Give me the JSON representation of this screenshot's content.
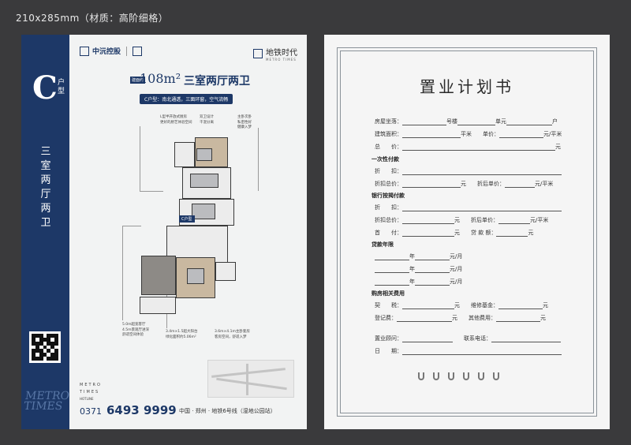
{
  "spec_caption": "210x285mm（材质：高阶细格）",
  "left": {
    "unit_letter": "C",
    "unit_sub": "户型",
    "band_text": "三室两厅两卫",
    "logo_left_name": "中沅控股",
    "logo_right_name": "地铁时代",
    "logo_right_en": "METRO TIMES",
    "area_badge": "建面约",
    "area": "108m²",
    "rooms": "三室两厅两卫",
    "c_tag": "C户型：南北通透，三面环窗，空气流畅",
    "plan_label": "C户型",
    "notes": [
      {
        "lines": [
          "L型半开放式厨房",
          "更好的厨艺体验空间"
        ]
      },
      {
        "lines": [
          "双卫设计",
          "干湿分离"
        ]
      },
      {
        "lines": [
          "主卧次卧",
          "私密性好",
          "健康入梦"
        ]
      },
      {
        "lines": [
          "5.0m超宽客厅",
          "4.5m景观厅进深",
          "舒适空间体验"
        ]
      },
      {
        "lines": [
          "3.4m×1.5超大阳台",
          "绿化面积约5.06m²"
        ]
      },
      {
        "lines": [
          "3.6m×4.1m主卧套房",
          "客房空间，舒适入梦"
        ]
      }
    ],
    "metro_en_1": "METRO",
    "metro_en_2": "TIMES",
    "deco_1": "METRO",
    "deco_2": "TIMES",
    "hotline_label": "HOTLINE",
    "area_code": "0371",
    "phone": "6493 9999",
    "address": "中国 · 郑州 · 地铁6号线（湿地公园站）"
  },
  "right": {
    "title": "置业计划书",
    "rows": {
      "house_no_label": "房屋坐落：",
      "bldg": "号楼",
      "unit": "单元",
      "hu": "户",
      "area_label": "建筑面积：",
      "sqm": "平米",
      "price_label": "单价：",
      "yuan_sqm": "元/平米",
      "total_label": "总　　价：",
      "yuan": "元",
      "s1": "一次性付款",
      "discount_label": "折　　扣：",
      "disc_total_label": "折扣总价：",
      "disc_price_label": "折后单价：",
      "s2": "银行按揭付款",
      "down_label": "首　　付：",
      "loan_amt_label": "贷 款 额：",
      "s3": "贷款年限",
      "year": "年",
      "per_month": "元/月",
      "s4": "购房相关费用",
      "deed_label": "契　　税：",
      "maint_label": "维修基金：",
      "reg_label": "登记费：",
      "other_label": "其他费用：",
      "consultant_label": "置业顾问：",
      "contact_label": "联系电话：",
      "date_label": "日　　期："
    }
  }
}
